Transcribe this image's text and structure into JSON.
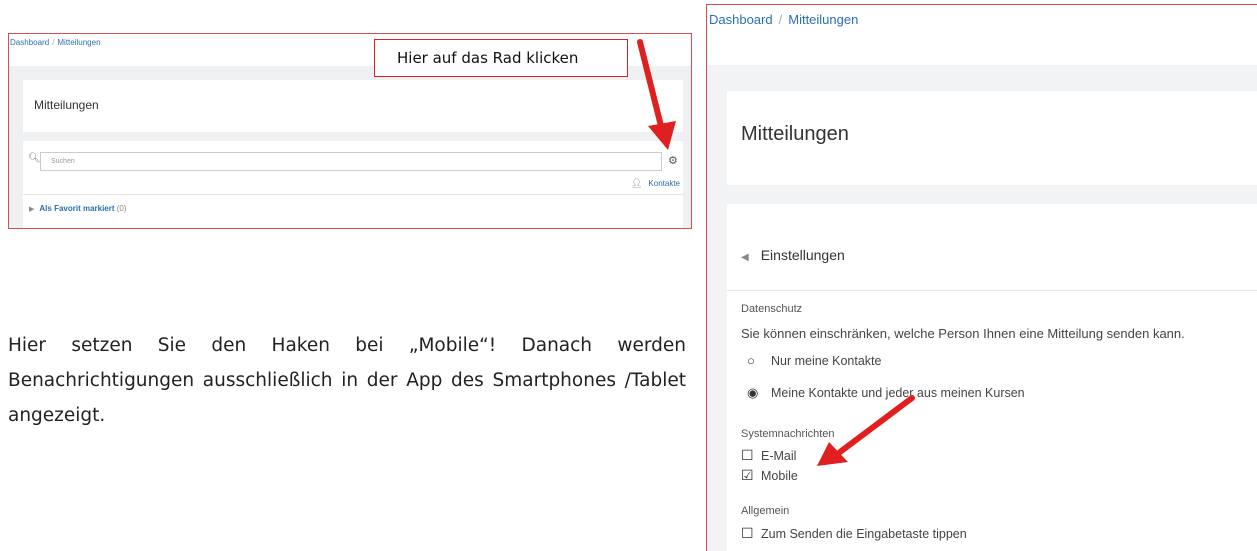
{
  "left_screenshot": {
    "breadcrumb": [
      "Dashboard",
      "Mitteilungen"
    ],
    "breadcrumb_separator": "/",
    "title": "Mitteilungen",
    "search_placeholder": "Suchen",
    "contacts_link": "Kontakte",
    "favorites": {
      "label": "Als Favorit markiert",
      "count": "(0)"
    },
    "callout": "Hier auf das Rad klicken"
  },
  "instruction": "Hier setzen Sie den Haken bei „Mobile“! Danach werden Benachrichtigungen ausschließlich in der App des Smartphones /Tablet angezeigt.",
  "right_screenshot": {
    "breadcrumb": [
      "Dashboard",
      "Mitteilungen"
    ],
    "breadcrumb_separator": "/",
    "title": "Mitteilungen",
    "settings_header": "Einstellungen",
    "privacy": {
      "label": "Datenschutz",
      "description": "Sie können einschränken, welche Person Ihnen eine Mitteilung senden kann.",
      "options": [
        {
          "label": "Nur meine Kontakte",
          "selected": false
        },
        {
          "label": "Meine Kontakte und jeder aus meinen Kursen",
          "selected": true
        }
      ]
    },
    "system_messages": {
      "label": "Systemnachrichten",
      "options": [
        {
          "label": "E-Mail",
          "checked": false
        },
        {
          "label": "Mobile",
          "checked": true
        }
      ]
    },
    "general": {
      "label": "Allgemein",
      "options": [
        {
          "label": "Zum Senden die Eingabetaste tippen",
          "checked": false
        }
      ]
    }
  },
  "colors": {
    "annotation_red": "#e02020",
    "link_blue": "#2a6fb0",
    "frame_red": "#d35050"
  }
}
